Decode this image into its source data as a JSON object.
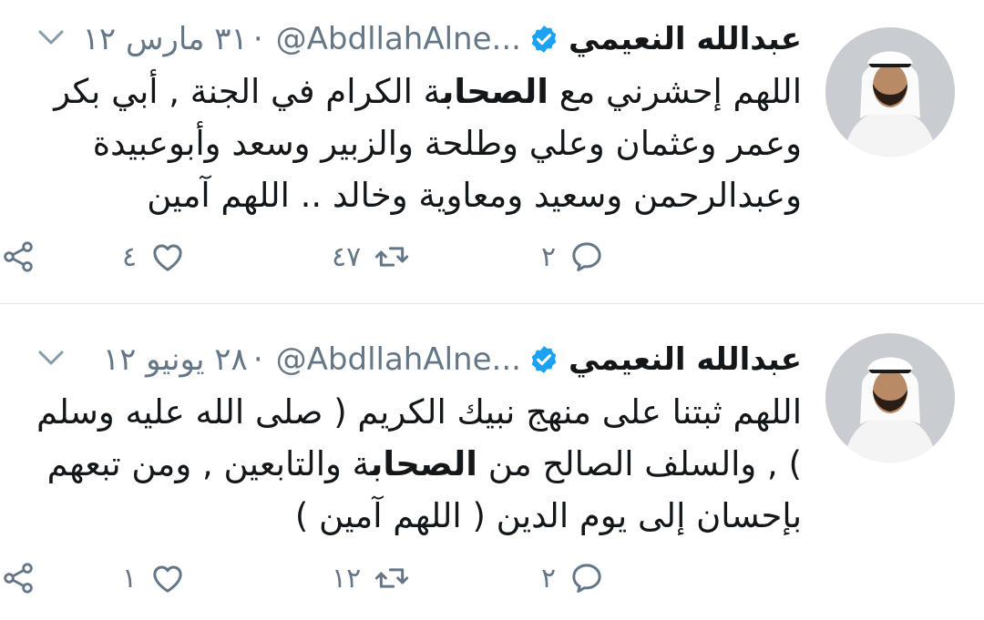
{
  "colors": {
    "accent": "#1da1f2",
    "muted": "#657786",
    "text": "#14171a",
    "divider": "#e1e8ed"
  },
  "tweets": [
    {
      "name": "عبدالله النعيمي",
      "handle": "@AbdllahAlne...",
      "separator": "·",
      "date": "٣١ مارس ١٢",
      "text_parts": [
        "اللهم إحشرني مع ",
        "الصحاب",
        "ة الكرام في الجنة , أبي بكر وعمر وعثمان وعلي وطلحة والزبير وسعد وأبوعبيدة وعبدالرحمن وسعيد ومعاوية وخالد .. اللهم آمين"
      ],
      "replies": "٢",
      "retweets": "٤٧",
      "likes": "٤",
      "icons": [
        "chevron-down-icon",
        "verified-badge-icon",
        "reply-icon",
        "retweet-icon",
        "like-icon",
        "share-icon"
      ]
    },
    {
      "name": "عبدالله النعيمي",
      "handle": "@AbdllahAlne...",
      "separator": "·",
      "date": "٢٨ يونيو ١٢",
      "text_parts": [
        "اللهم ثبتنا على منهج نبيك الكريم ( صلى الله عليه وسلم ) , والسلف الصالح من ",
        "الصحاب",
        "ة والتابعين , ومن تبعهم بإحسان إلى يوم الدين ( اللهم آمين )"
      ],
      "replies": "٢",
      "retweets": "١٢",
      "likes": "١",
      "icons": [
        "chevron-down-icon",
        "verified-badge-icon",
        "reply-icon",
        "retweet-icon",
        "like-icon",
        "share-icon"
      ]
    }
  ]
}
